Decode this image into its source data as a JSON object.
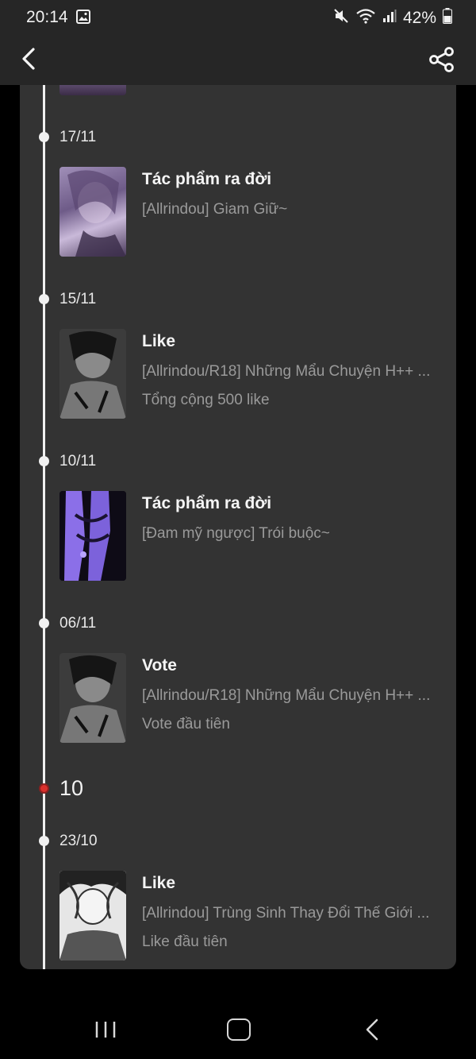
{
  "status_bar": {
    "time": "20:14",
    "battery": "42%",
    "icons": [
      "image-icon",
      "mute-icon",
      "wifi-icon",
      "signal-icon",
      "battery-icon"
    ]
  },
  "app_bar": {
    "back_icon": "chevron-left-icon",
    "share_icon": "share-icon"
  },
  "timeline": [
    {
      "date": "17/11",
      "title": "Tác phẩm ra đời",
      "work": "[Allrindou] Giam Giữ~",
      "detail": ""
    },
    {
      "date": "15/11",
      "title": "Like",
      "work": "[Allrindou/R18] Những Mẩu Chuyện H++ ...",
      "detail": "Tổng cộng 500 like"
    },
    {
      "date": "10/11",
      "title": "Tác phẩm ra đời",
      "work": "[Đam mỹ ngược] Trói buộc~",
      "detail": ""
    },
    {
      "date": "06/11",
      "title": "Vote",
      "work": "[Allrindou/R18] Những Mẩu Chuyện H++ ...",
      "detail": "Vote đầu tiên"
    },
    {
      "month": "10"
    },
    {
      "date": "23/10",
      "title": "Like",
      "work": "[Allrindou] Trùng Sinh Thay Đổi Thế Giới ...",
      "detail": "Like đầu tiên"
    }
  ],
  "colors": {
    "background": "#333333",
    "bar": "#262626",
    "timeline": "#f0f0f0",
    "month_dot": "#d9302c",
    "secondary_text": "#9a9a9a"
  }
}
